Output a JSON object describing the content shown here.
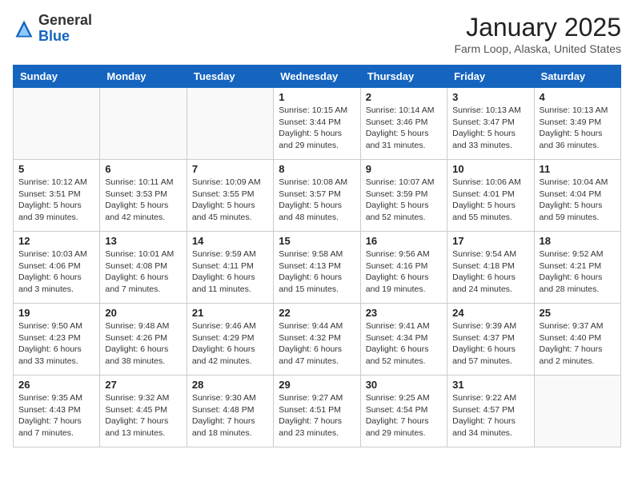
{
  "header": {
    "logo_general": "General",
    "logo_blue": "Blue",
    "title": "January 2025",
    "subtitle": "Farm Loop, Alaska, United States"
  },
  "weekdays": [
    "Sunday",
    "Monday",
    "Tuesday",
    "Wednesday",
    "Thursday",
    "Friday",
    "Saturday"
  ],
  "weeks": [
    [
      {
        "day": "",
        "info": ""
      },
      {
        "day": "",
        "info": ""
      },
      {
        "day": "",
        "info": ""
      },
      {
        "day": "1",
        "info": "Sunrise: 10:15 AM\nSunset: 3:44 PM\nDaylight: 5 hours\nand 29 minutes."
      },
      {
        "day": "2",
        "info": "Sunrise: 10:14 AM\nSunset: 3:46 PM\nDaylight: 5 hours\nand 31 minutes."
      },
      {
        "day": "3",
        "info": "Sunrise: 10:13 AM\nSunset: 3:47 PM\nDaylight: 5 hours\nand 33 minutes."
      },
      {
        "day": "4",
        "info": "Sunrise: 10:13 AM\nSunset: 3:49 PM\nDaylight: 5 hours\nand 36 minutes."
      }
    ],
    [
      {
        "day": "5",
        "info": "Sunrise: 10:12 AM\nSunset: 3:51 PM\nDaylight: 5 hours\nand 39 minutes."
      },
      {
        "day": "6",
        "info": "Sunrise: 10:11 AM\nSunset: 3:53 PM\nDaylight: 5 hours\nand 42 minutes."
      },
      {
        "day": "7",
        "info": "Sunrise: 10:09 AM\nSunset: 3:55 PM\nDaylight: 5 hours\nand 45 minutes."
      },
      {
        "day": "8",
        "info": "Sunrise: 10:08 AM\nSunset: 3:57 PM\nDaylight: 5 hours\nand 48 minutes."
      },
      {
        "day": "9",
        "info": "Sunrise: 10:07 AM\nSunset: 3:59 PM\nDaylight: 5 hours\nand 52 minutes."
      },
      {
        "day": "10",
        "info": "Sunrise: 10:06 AM\nSunset: 4:01 PM\nDaylight: 5 hours\nand 55 minutes."
      },
      {
        "day": "11",
        "info": "Sunrise: 10:04 AM\nSunset: 4:04 PM\nDaylight: 5 hours\nand 59 minutes."
      }
    ],
    [
      {
        "day": "12",
        "info": "Sunrise: 10:03 AM\nSunset: 4:06 PM\nDaylight: 6 hours\nand 3 minutes."
      },
      {
        "day": "13",
        "info": "Sunrise: 10:01 AM\nSunset: 4:08 PM\nDaylight: 6 hours\nand 7 minutes."
      },
      {
        "day": "14",
        "info": "Sunrise: 9:59 AM\nSunset: 4:11 PM\nDaylight: 6 hours\nand 11 minutes."
      },
      {
        "day": "15",
        "info": "Sunrise: 9:58 AM\nSunset: 4:13 PM\nDaylight: 6 hours\nand 15 minutes."
      },
      {
        "day": "16",
        "info": "Sunrise: 9:56 AM\nSunset: 4:16 PM\nDaylight: 6 hours\nand 19 minutes."
      },
      {
        "day": "17",
        "info": "Sunrise: 9:54 AM\nSunset: 4:18 PM\nDaylight: 6 hours\nand 24 minutes."
      },
      {
        "day": "18",
        "info": "Sunrise: 9:52 AM\nSunset: 4:21 PM\nDaylight: 6 hours\nand 28 minutes."
      }
    ],
    [
      {
        "day": "19",
        "info": "Sunrise: 9:50 AM\nSunset: 4:23 PM\nDaylight: 6 hours\nand 33 minutes."
      },
      {
        "day": "20",
        "info": "Sunrise: 9:48 AM\nSunset: 4:26 PM\nDaylight: 6 hours\nand 38 minutes."
      },
      {
        "day": "21",
        "info": "Sunrise: 9:46 AM\nSunset: 4:29 PM\nDaylight: 6 hours\nand 42 minutes."
      },
      {
        "day": "22",
        "info": "Sunrise: 9:44 AM\nSunset: 4:32 PM\nDaylight: 6 hours\nand 47 minutes."
      },
      {
        "day": "23",
        "info": "Sunrise: 9:41 AM\nSunset: 4:34 PM\nDaylight: 6 hours\nand 52 minutes."
      },
      {
        "day": "24",
        "info": "Sunrise: 9:39 AM\nSunset: 4:37 PM\nDaylight: 6 hours\nand 57 minutes."
      },
      {
        "day": "25",
        "info": "Sunrise: 9:37 AM\nSunset: 4:40 PM\nDaylight: 7 hours\nand 2 minutes."
      }
    ],
    [
      {
        "day": "26",
        "info": "Sunrise: 9:35 AM\nSunset: 4:43 PM\nDaylight: 7 hours\nand 7 minutes."
      },
      {
        "day": "27",
        "info": "Sunrise: 9:32 AM\nSunset: 4:45 PM\nDaylight: 7 hours\nand 13 minutes."
      },
      {
        "day": "28",
        "info": "Sunrise: 9:30 AM\nSunset: 4:48 PM\nDaylight: 7 hours\nand 18 minutes."
      },
      {
        "day": "29",
        "info": "Sunrise: 9:27 AM\nSunset: 4:51 PM\nDaylight: 7 hours\nand 23 minutes."
      },
      {
        "day": "30",
        "info": "Sunrise: 9:25 AM\nSunset: 4:54 PM\nDaylight: 7 hours\nand 29 minutes."
      },
      {
        "day": "31",
        "info": "Sunrise: 9:22 AM\nSunset: 4:57 PM\nDaylight: 7 hours\nand 34 minutes."
      },
      {
        "day": "",
        "info": ""
      }
    ]
  ]
}
